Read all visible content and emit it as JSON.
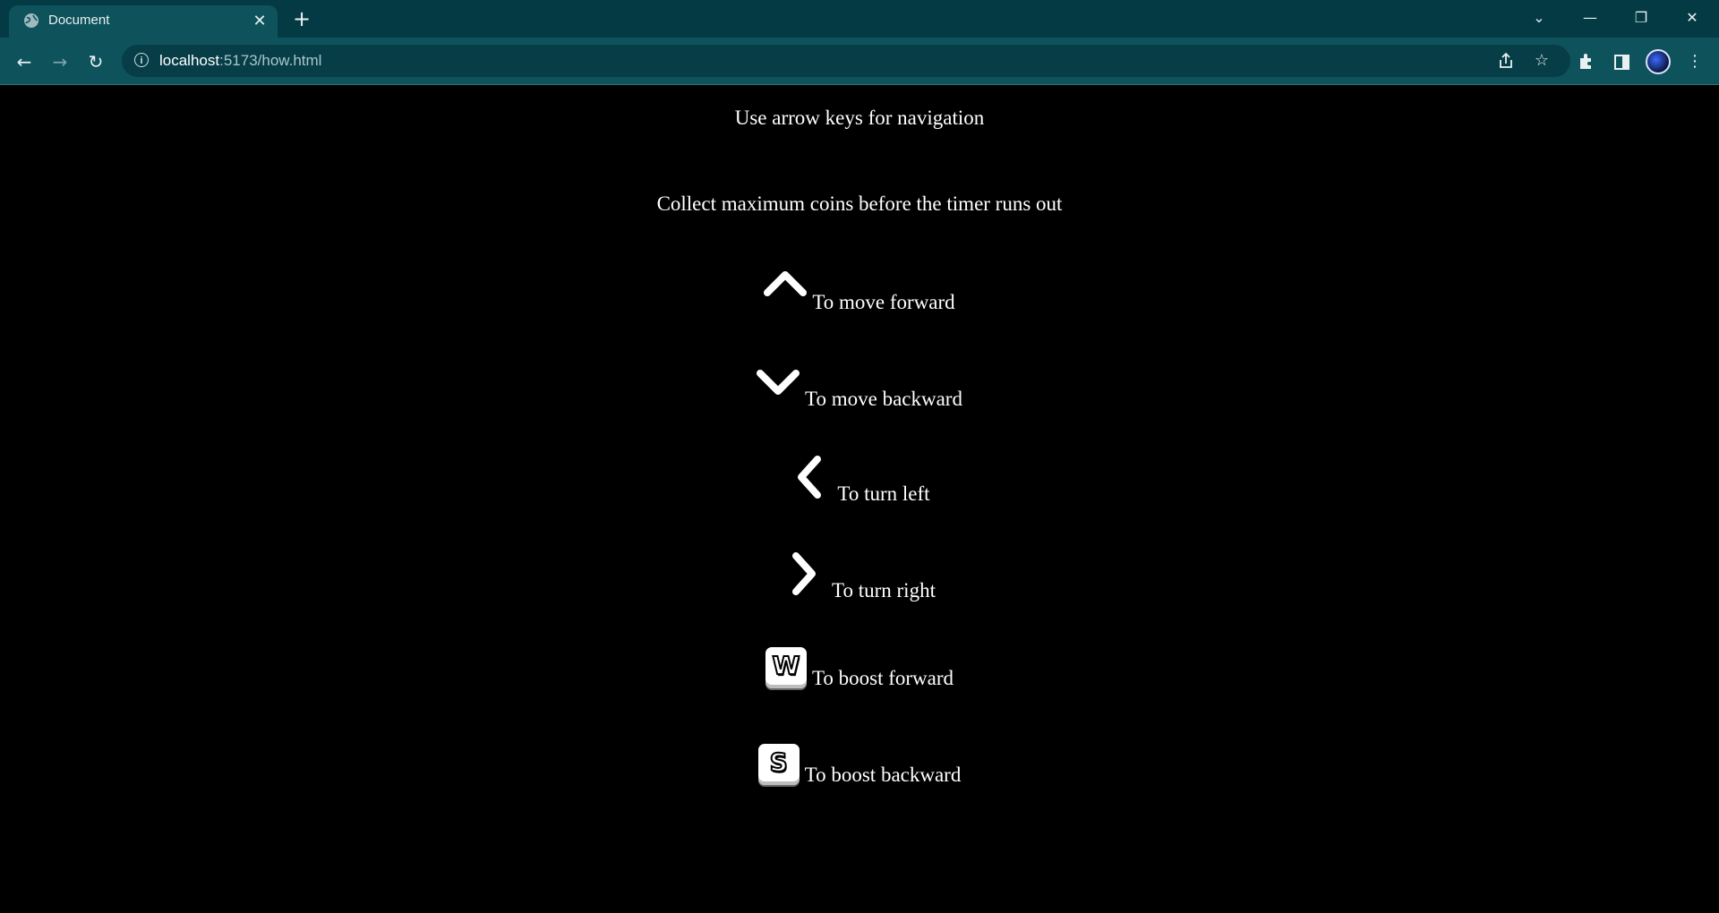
{
  "browser": {
    "tab_title": "Document",
    "tab_close": "✕",
    "new_tab": "+",
    "url_host": "localhost",
    "url_rest": ":5173/how.html",
    "window_controls": {
      "tab_search": "⌄",
      "minimize": "—",
      "restore": "❐",
      "close": "✕"
    },
    "nav": {
      "back": "←",
      "forward": "→",
      "reload": "↻"
    },
    "icons": [
      "site-info-icon",
      "share-icon",
      "bookmark-star-icon",
      "extensions-icon",
      "side-panel-icon",
      "profile-avatar",
      "menu-icon"
    ]
  },
  "page": {
    "intro": "Use arrow keys for navigation",
    "goal": "Collect maximum coins before the timer runs out",
    "controls": [
      {
        "key": "arrow-up",
        "label": "To move forward"
      },
      {
        "key": "arrow-down",
        "label": "To move backward"
      },
      {
        "key": "arrow-left",
        "label": "To turn left"
      },
      {
        "key": "arrow-right",
        "label": "To turn right"
      },
      {
        "key": "W",
        "label": "To boost forward"
      },
      {
        "key": "S",
        "label": "To boost backward"
      }
    ]
  },
  "colors": {
    "titlebar": "#043a44",
    "toolbar": "#0e525c",
    "page_background": "#000000",
    "text": "#ffffff"
  }
}
